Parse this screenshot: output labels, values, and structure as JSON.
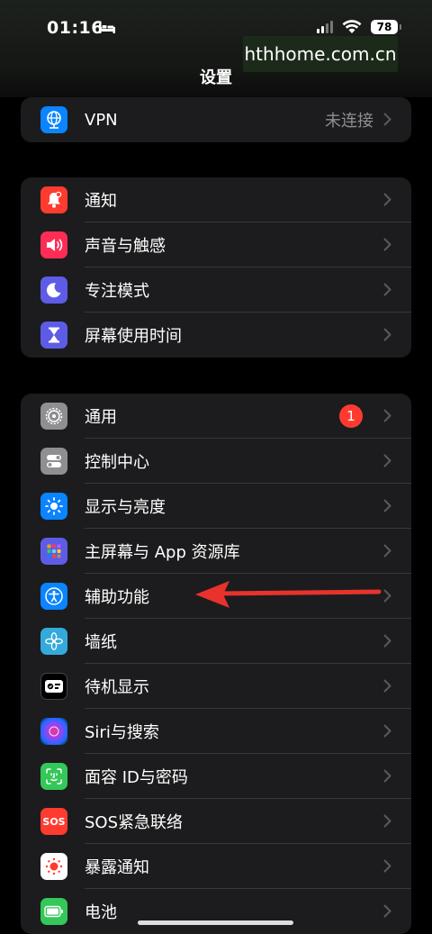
{
  "status": {
    "time": "01:16",
    "battery": "78"
  },
  "watermark": "hthhome.com.cn",
  "nav": {
    "title": "设置"
  },
  "groups": [
    {
      "items": [
        {
          "label": "VPN",
          "value": "未连接",
          "icon": "vpn-globe-icon",
          "color": "#0a84ff"
        }
      ]
    },
    {
      "items": [
        {
          "label": "通知",
          "icon": "bell-icon",
          "color": "#ff3b30"
        },
        {
          "label": "声音与触感",
          "icon": "speaker-icon",
          "color": "#ff2d55"
        },
        {
          "label": "专注模式",
          "icon": "moon-icon",
          "color": "#5e5ce6"
        },
        {
          "label": "屏幕使用时间",
          "icon": "hourglass-icon",
          "color": "#5e5ce6"
        }
      ]
    },
    {
      "items": [
        {
          "label": "通用",
          "badge": "1",
          "icon": "gear-icon",
          "color": "#8e8e93"
        },
        {
          "label": "控制中心",
          "icon": "toggles-icon",
          "color": "#8e8e93"
        },
        {
          "label": "显示与亮度",
          "icon": "sun-icon",
          "color": "#0a84ff"
        },
        {
          "label": "主屏幕与 App 资源库",
          "icon": "app-grid-icon",
          "color": "#5e5ce6"
        },
        {
          "label": "辅助功能",
          "icon": "accessibility-icon",
          "color": "#0a84ff"
        },
        {
          "label": "墙纸",
          "icon": "flower-icon",
          "color": "#34aadc"
        },
        {
          "label": "待机显示",
          "icon": "standby-icon",
          "color": "#000000"
        },
        {
          "label": "Siri与搜索",
          "icon": "siri-icon",
          "color": "#222222"
        },
        {
          "label": "面容 ID与密码",
          "icon": "face-id-icon",
          "color": "#34c759"
        },
        {
          "label": "SOS紧急联络",
          "icon": "sos-icon",
          "color": "#ff3b30",
          "icon_text": "SOS"
        },
        {
          "label": "暴露通知",
          "icon": "exposure-icon",
          "color": "#ffffff"
        },
        {
          "label": "电池",
          "icon": "battery-icon",
          "color": "#34c759"
        }
      ]
    }
  ],
  "colors": {
    "accent": "#0a84ff",
    "arrow": "#e8322c"
  }
}
